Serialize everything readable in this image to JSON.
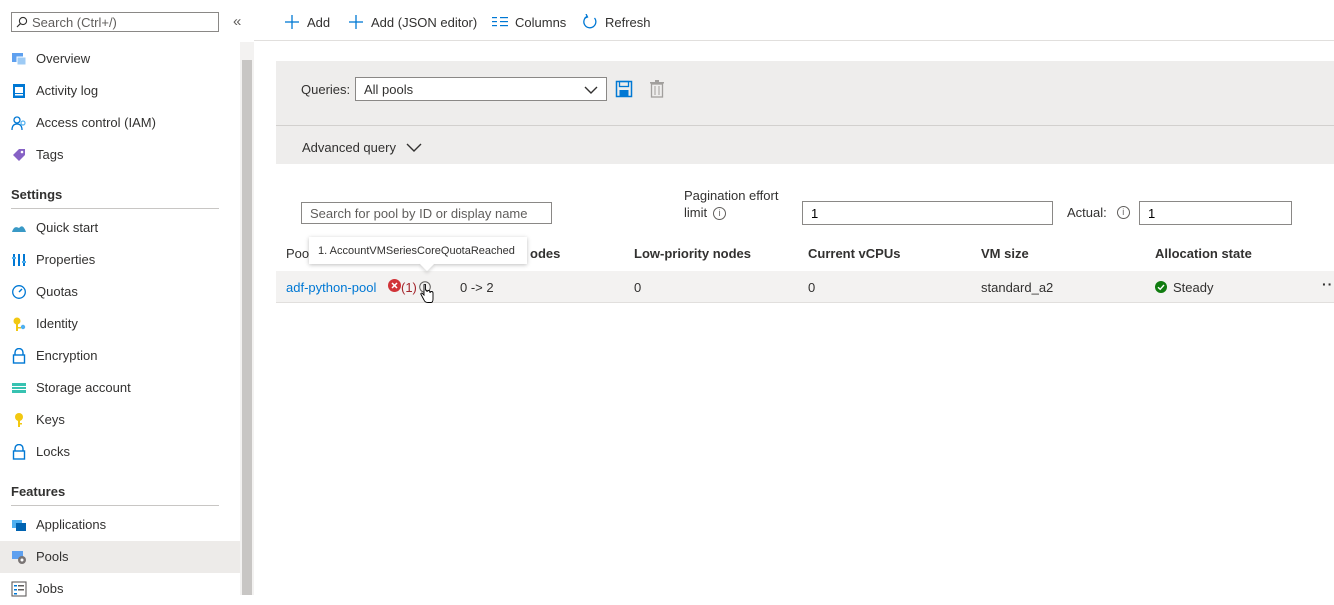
{
  "sidebar": {
    "search_placeholder": "Search (Ctrl+/)",
    "collapse_glyph": "«",
    "items_top": [
      {
        "label": "Overview",
        "icon": "overview-icon"
      },
      {
        "label": "Activity log",
        "icon": "activity-log-icon"
      },
      {
        "label": "Access control (IAM)",
        "icon": "access-control-icon"
      },
      {
        "label": "Tags",
        "icon": "tag-icon"
      }
    ],
    "settings_heading": "Settings",
    "settings_items": [
      {
        "label": "Quick start",
        "icon": "quick-start-icon"
      },
      {
        "label": "Properties",
        "icon": "properties-icon"
      },
      {
        "label": "Quotas",
        "icon": "quotas-icon"
      },
      {
        "label": "Identity",
        "icon": "identity-icon"
      },
      {
        "label": "Encryption",
        "icon": "lock-icon"
      },
      {
        "label": "Storage account",
        "icon": "storage-account-icon"
      },
      {
        "label": "Keys",
        "icon": "key-icon"
      },
      {
        "label": "Locks",
        "icon": "lock-icon"
      }
    ],
    "features_heading": "Features",
    "features_items": [
      {
        "label": "Applications",
        "icon": "applications-icon"
      },
      {
        "label": "Pools",
        "icon": "pools-icon",
        "selected": true
      },
      {
        "label": "Jobs",
        "icon": "jobs-icon"
      }
    ]
  },
  "toolbar": {
    "add_label": "Add",
    "add_json_label": "Add (JSON editor)",
    "columns_label": "Columns",
    "refresh_label": "Refresh"
  },
  "query": {
    "label": "Queries:",
    "selected": "All pools",
    "advanced_label": "Advanced query"
  },
  "filters": {
    "pool_search_placeholder": "Search for pool by ID or display name",
    "pagination_label_line1": "Pagination effort",
    "pagination_label_line2": "limit",
    "pagination_value": "1",
    "actual_label": "Actual:",
    "actual_value": "1"
  },
  "table": {
    "columns": {
      "pool_partial": "Poo",
      "dedicated_partial": "odes",
      "low_priority": "Low-priority nodes",
      "current_vcpus": "Current vCPUs",
      "vm_size": "VM size",
      "allocation_state": "Allocation state"
    },
    "rows": [
      {
        "pool_id": "adf-python-pool",
        "error_count": "(1)",
        "dedicated_nodes": "0 -> 2",
        "low_priority_nodes": "0",
        "current_vcpus": "0",
        "vm_size": "standard_a2",
        "allocation_state": "Steady",
        "more": "···"
      }
    ],
    "tooltip": "1. AccountVMSeriesCoreQuotaReached"
  },
  "colors": {
    "accent": "#0078d4",
    "error": "#a4262c",
    "success": "#107c10",
    "panel_bg": "#eeedec"
  }
}
